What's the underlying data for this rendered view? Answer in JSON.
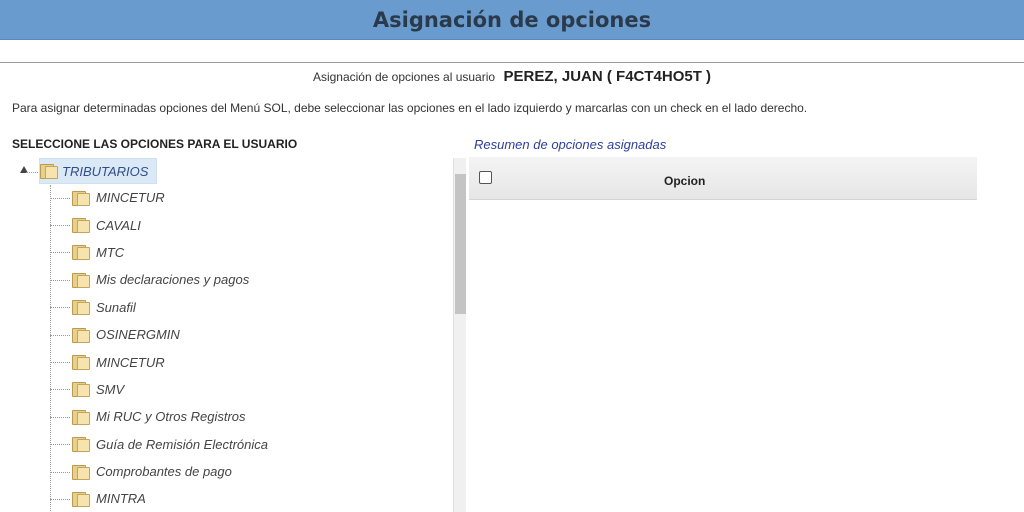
{
  "page": {
    "title": "Asignación de opciones",
    "user_label": "Asignación de opciones al usuario",
    "user_name": "PEREZ, JUAN ( F4CT4HO5T )",
    "instructions": "Para asignar determinadas opciones del Menú SOL, debe seleccionar las opciones en el lado izquierdo y marcarlas con un check en el lado derecho."
  },
  "tree": {
    "title": "SELECCIONE LAS OPCIONES PARA EL USUARIO",
    "root": {
      "label": "TRIBUTARIOS",
      "icon": "folder-icon",
      "expanded": true
    },
    "items": [
      {
        "label": "MINCETUR",
        "icon": "folder-icon"
      },
      {
        "label": "CAVALI",
        "icon": "folder-icon"
      },
      {
        "label": "MTC",
        "icon": "folder-icon"
      },
      {
        "label": "Mis declaraciones y pagos",
        "icon": "folder-icon"
      },
      {
        "label": "Sunafil",
        "icon": "folder-icon"
      },
      {
        "label": "OSINERGMIN",
        "icon": "folder-icon"
      },
      {
        "label": "MINCETUR",
        "icon": "folder-icon"
      },
      {
        "label": "SMV",
        "icon": "folder-icon"
      },
      {
        "label": "Mi RUC y Otros Registros",
        "icon": "folder-icon"
      },
      {
        "label": "Guía de Remisión Electrónica",
        "icon": "folder-icon"
      },
      {
        "label": "Comprobantes de pago",
        "icon": "folder-icon"
      },
      {
        "label": "MINTRA",
        "icon": "folder-icon"
      }
    ]
  },
  "summary": {
    "title": "Resumen de opciones asignadas",
    "columns": [
      "Opcion"
    ],
    "rows": []
  },
  "colors": {
    "header_bg": "#6a9bcf",
    "selected_bg": "#dbe9f7",
    "summary_title": "#2e3f9a"
  }
}
